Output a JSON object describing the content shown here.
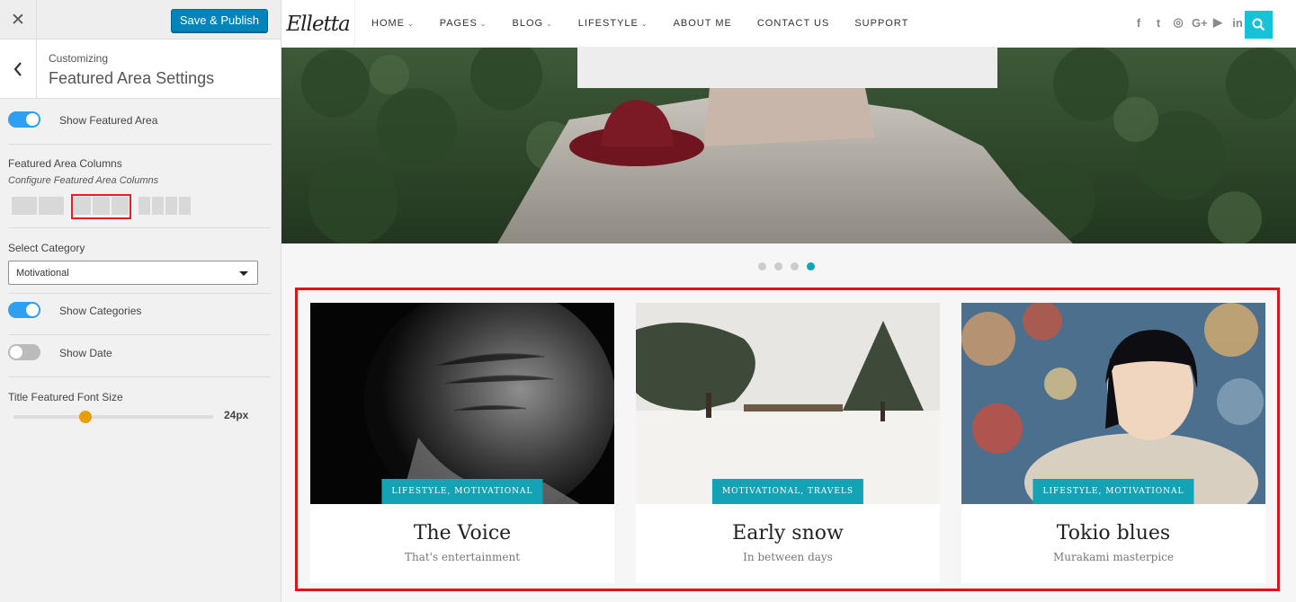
{
  "customizer": {
    "save_label": "Save & Publish",
    "breadcrumb": "Customizing",
    "section_title": "Featured Area Settings",
    "controls": {
      "show_featured_area": {
        "label": "Show Featured Area",
        "enabled": true
      },
      "featured_columns": {
        "label": "Featured Area Columns",
        "description": "Configure Featured Area Columns",
        "options": [
          2,
          3,
          4
        ],
        "selected": 3
      },
      "select_category": {
        "label": "Select Category",
        "value": "Motivational"
      },
      "show_categories": {
        "label": "Show Categories",
        "enabled": true
      },
      "show_date": {
        "label": "Show Date",
        "enabled": false
      },
      "title_font_size": {
        "label": "Title Featured Font Size",
        "value_text": "24px",
        "position": 0.36
      }
    }
  },
  "site": {
    "logo": "Elletta",
    "menu": [
      {
        "label": "HOME",
        "has_dropdown": true
      },
      {
        "label": "PAGES",
        "has_dropdown": true
      },
      {
        "label": "BLOG",
        "has_dropdown": true
      },
      {
        "label": "LIFESTYLE",
        "has_dropdown": true
      },
      {
        "label": "ABOUT ME",
        "has_dropdown": false
      },
      {
        "label": "CONTACT US",
        "has_dropdown": false
      },
      {
        "label": "SUPPORT",
        "has_dropdown": false
      }
    ],
    "social_icons": [
      "facebook-icon",
      "twitter-icon",
      "instagram-icon",
      "google-plus-icon",
      "youtube-icon",
      "linkedin-icon"
    ],
    "social_glyphs": [
      "f",
      "t",
      "◎",
      "G+",
      "▶",
      "in"
    ],
    "accent_color": "#14a3b4",
    "slider": {
      "total": 4,
      "active": 4
    },
    "featured_posts": [
      {
        "category": "LIFESTYLE, MOTIVATIONAL",
        "title": "The Voice",
        "subtitle": "That's entertainment",
        "image": "grayscale-portrait-old-man"
      },
      {
        "category": "MOTIVATIONAL, TRAVELS",
        "title": "Early snow",
        "subtitle": "In between days",
        "image": "snowy-field-pines-deer"
      },
      {
        "category": "LIFESTYLE, MOTIVATIONAL",
        "title": "Tokio blues",
        "subtitle": "Murakami masterpice",
        "image": "woman-fur-hood-city-bokeh"
      }
    ]
  }
}
